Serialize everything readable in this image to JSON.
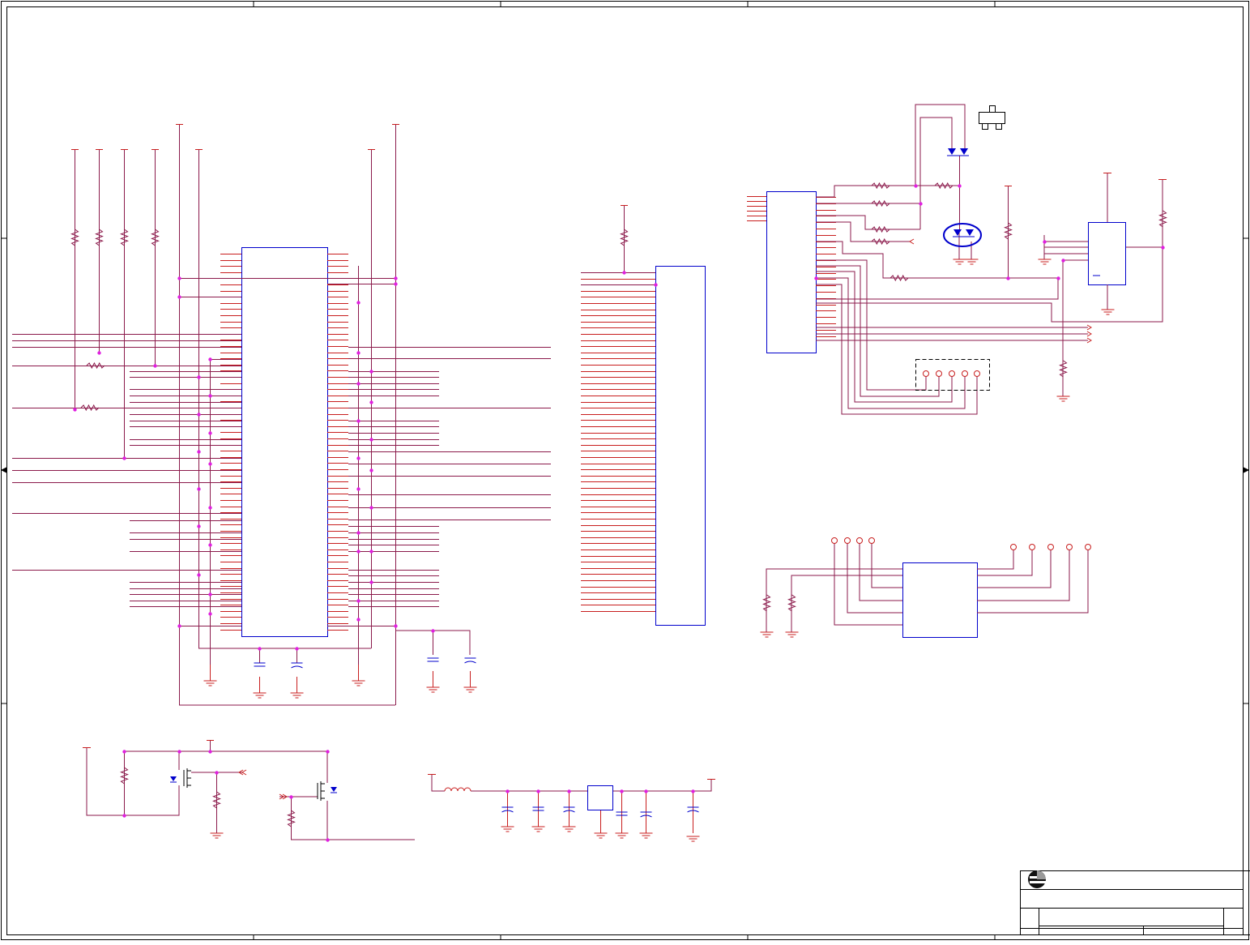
{
  "document": {
    "type": "electronic schematic sheet",
    "colors": {
      "wire": "#8b1a4b",
      "pin": "#c81e1e",
      "component": "#0000cc",
      "junction": "#e020e0",
      "frame": "#000000"
    }
  },
  "title_block": {
    "logo": "company-logo"
  }
}
